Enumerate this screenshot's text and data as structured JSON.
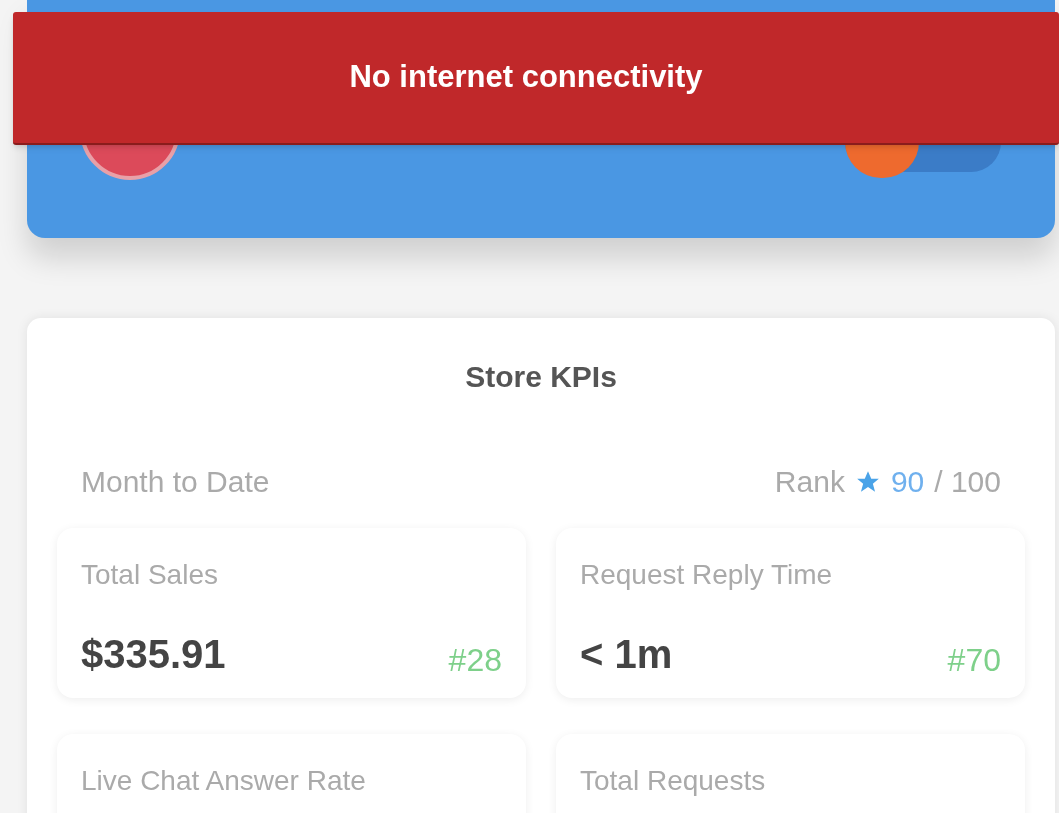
{
  "header": {
    "toggle": {
      "on": false
    }
  },
  "banner": {
    "message": "No internet connectivity"
  },
  "kpis": {
    "title": "Store KPIs",
    "period": "Month to Date",
    "rank": {
      "label": "Rank",
      "value": "90",
      "total": "/ 100"
    },
    "tiles": [
      {
        "label": "Total Sales",
        "value": "$335.91",
        "rank": "#28"
      },
      {
        "label": "Request Reply Time",
        "value": "< 1m",
        "rank": "#70"
      },
      {
        "label": "Live Chat Answer Rate"
      },
      {
        "label": "Total Requests"
      }
    ]
  }
}
